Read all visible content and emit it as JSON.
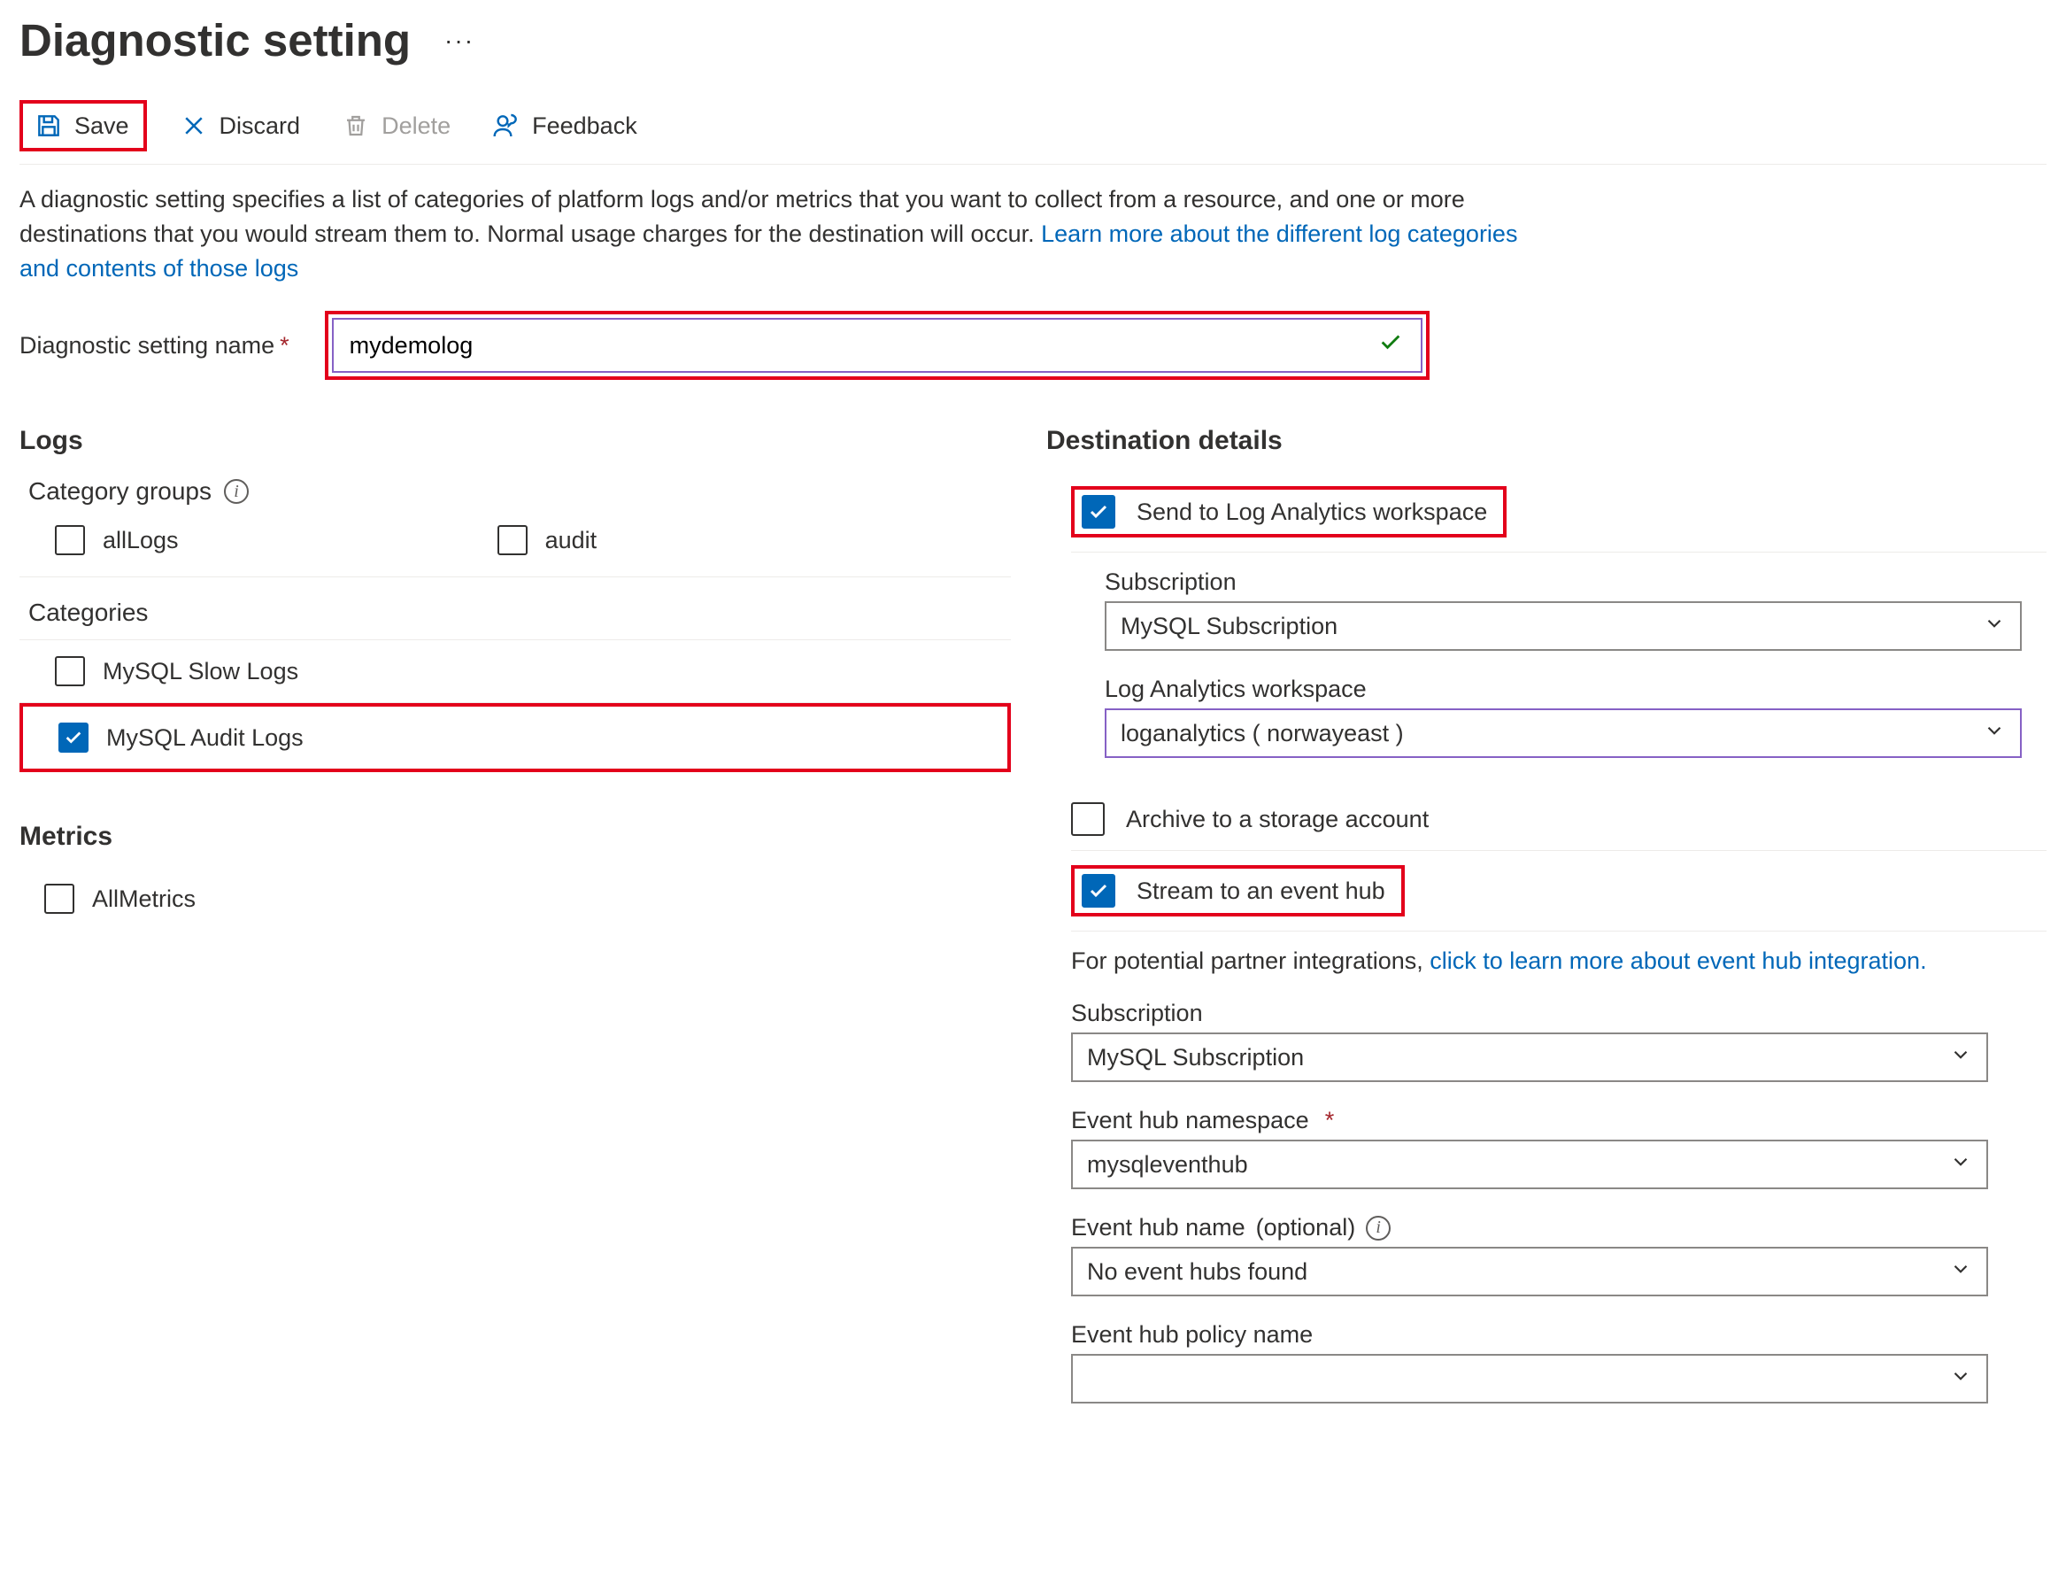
{
  "header": {
    "title": "Diagnostic setting"
  },
  "toolbar": {
    "save": "Save",
    "discard": "Discard",
    "delete": "Delete",
    "feedback": "Feedback"
  },
  "intro": {
    "text": "A diagnostic setting specifies a list of categories of platform logs and/or metrics that you want to collect from a resource, and one or more destinations that you would stream them to. Normal usage charges for the destination will occur. ",
    "link": "Learn more about the different log categories and contents of those logs"
  },
  "nameField": {
    "label": "Diagnostic setting name",
    "value": "mydemolog"
  },
  "logs": {
    "heading": "Logs",
    "categoryGroupsLabel": "Category groups",
    "groups": {
      "allLogs": {
        "label": "allLogs",
        "checked": false
      },
      "audit": {
        "label": "audit",
        "checked": false
      }
    },
    "categoriesLabel": "Categories",
    "categories": {
      "slow": {
        "label": "MySQL Slow Logs",
        "checked": false
      },
      "audit": {
        "label": "MySQL Audit Logs",
        "checked": true
      }
    }
  },
  "metrics": {
    "heading": "Metrics",
    "all": {
      "label": "AllMetrics",
      "checked": false
    }
  },
  "dest": {
    "heading": "Destination details",
    "law": {
      "label": "Send to Log Analytics workspace",
      "checked": true,
      "subscriptionLabel": "Subscription",
      "subscriptionValue": "MySQL Subscription",
      "workspaceLabel": "Log Analytics workspace",
      "workspaceValue": "loganalytics ( norwayeast )"
    },
    "storage": {
      "label": "Archive to a storage account",
      "checked": false
    },
    "eventhub": {
      "label": "Stream to an event hub",
      "checked": true,
      "note_pre": "For potential partner integrations, ",
      "note_link": "click to learn more about event hub integration.",
      "subscriptionLabel": "Subscription",
      "subscriptionValue": "MySQL Subscription",
      "namespaceLabel": "Event hub namespace",
      "namespaceValue": "mysqleventhub",
      "nameLabelPre": "Event hub name ",
      "nameLabelOptional": "(optional)",
      "nameValue": "No event hubs found",
      "policyLabel": "Event hub policy name",
      "policyValue": ""
    }
  }
}
